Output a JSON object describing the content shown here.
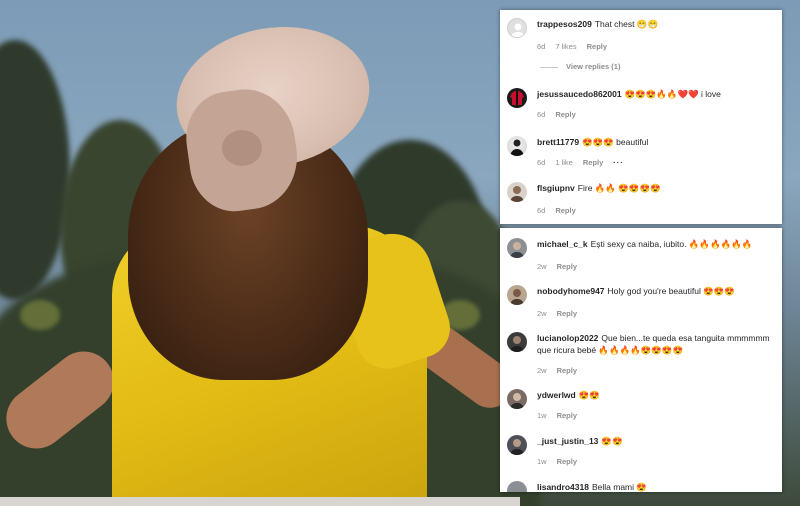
{
  "comments_top": [
    {
      "user": "trappesos209",
      "text": "That chest 😁😁",
      "time": "6d",
      "likes": "7 likes",
      "reply": "Reply",
      "avatar": "default"
    },
    {
      "user": "jesussaucedo862001",
      "text": "😍😍😍🔥🔥❤️❤️ i love",
      "time": "6d",
      "reply": "Reply",
      "avatar": "jersey"
    },
    {
      "user": "brett11779",
      "text": "😍😍😍 beautiful",
      "time": "6d",
      "likes": "1 like",
      "reply": "Reply",
      "more": "···",
      "avatar": "dark"
    },
    {
      "user": "flsgiupnv",
      "text": "Fire 🔥🔥 😍😍😍😍",
      "time": "6d",
      "reply": "Reply",
      "avatar": "face"
    }
  ],
  "view_replies": "View replies (1)",
  "comments_bottom": [
    {
      "user": "michael_c_k",
      "text": "Ești sexy ca naiba, iubito. 🔥🔥🔥🔥🔥🔥",
      "time": "2w",
      "reply": "Reply"
    },
    {
      "user": "nobodyhome947",
      "text": "Holy god you're beautiful 😍😍😍",
      "time": "2w",
      "reply": "Reply"
    },
    {
      "user": "lucianolop2022",
      "text": "Que bien...te queda esa tanguita mmmmmm que ricura bebé 🔥🔥🔥🔥😍😍😍😍",
      "time": "2w",
      "reply": "Reply"
    },
    {
      "user": "ydwerlwd",
      "text": "😍😍",
      "time": "1w",
      "reply": "Reply"
    },
    {
      "user": "_just_justin_13",
      "text": "😍😍",
      "time": "1w",
      "reply": "Reply"
    },
    {
      "user": "lisandro4318",
      "text": "Bella mami 😍",
      "time": "",
      "reply": ""
    }
  ],
  "colors": {
    "username": "#262626",
    "meta": "#8e8e8e",
    "panel_bg": "#ffffff"
  }
}
